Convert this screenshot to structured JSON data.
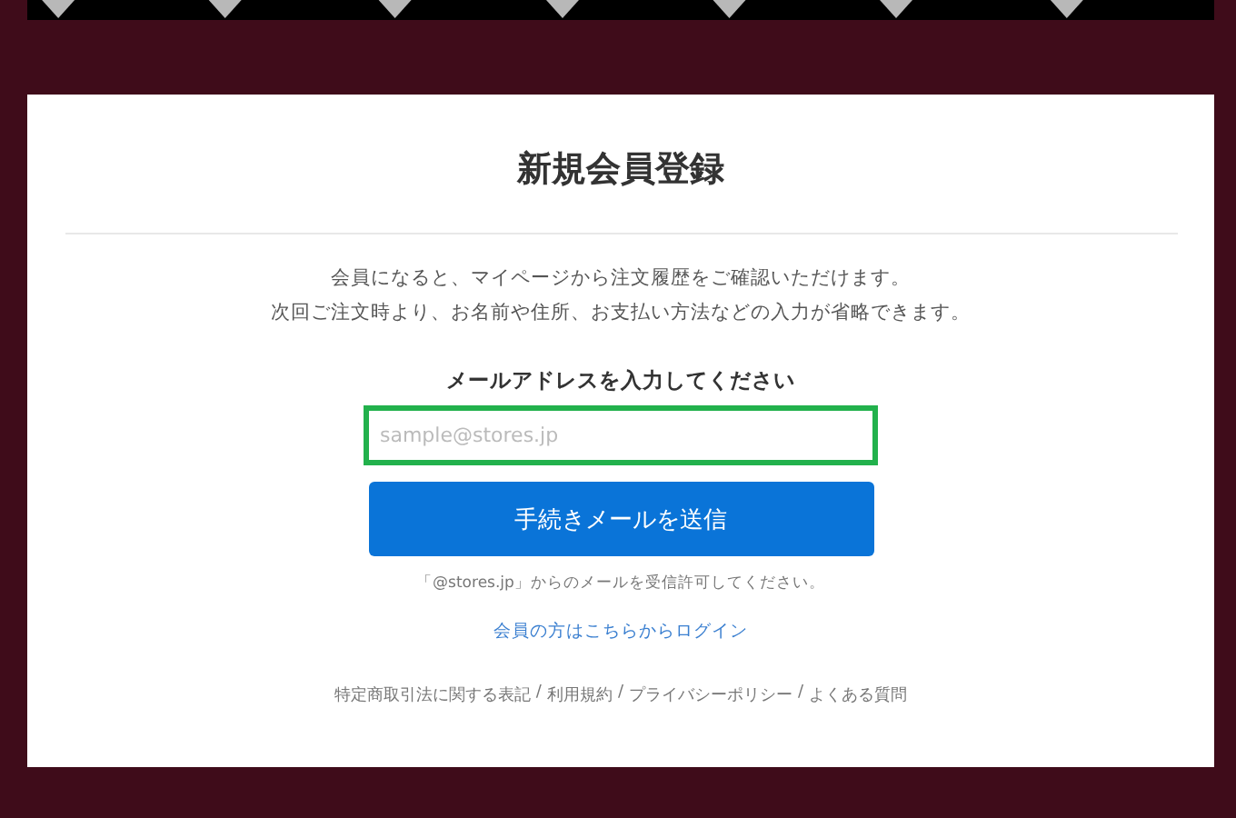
{
  "title": "新規会員登録",
  "intro": [
    "会員になると、マイページから注文履歴をご確認いただけます。",
    "次回ご注文時より、お名前や住所、お支払い方法などの入力が省略できます。"
  ],
  "email": {
    "label": "メールアドレスを入力してください",
    "placeholder": "sample@stores.jp",
    "highlighted": true
  },
  "submit": "手続きメールを送信",
  "note": "「@stores.jp」からのメールを受信許可してください。",
  "login_link": "会員の方はこちらからログイン",
  "footer": {
    "separator": "/",
    "links": [
      "特定商取引法に関する表記",
      "利用規約",
      "プライバシーポリシー",
      "よくある質問"
    ]
  }
}
